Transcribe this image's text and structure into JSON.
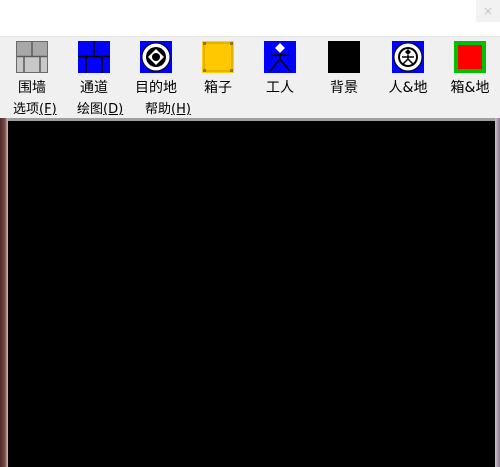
{
  "window": {
    "close_glyph": "×"
  },
  "toolbar": {
    "tools": [
      {
        "label": "围墙",
        "icon": "wall-icon"
      },
      {
        "label": "通道",
        "icon": "passage-icon"
      },
      {
        "label": "目的地",
        "icon": "target-icon"
      },
      {
        "label": "箱子",
        "icon": "box-icon"
      },
      {
        "label": "工人",
        "icon": "worker-icon"
      },
      {
        "label": "背景",
        "icon": "background-icon"
      },
      {
        "label": "人&地",
        "icon": "worker-on-target-icon"
      },
      {
        "label": "箱&地",
        "icon": "box-on-target-icon"
      }
    ]
  },
  "menu": {
    "items": [
      {
        "label": "选项",
        "hotkey": "(F)"
      },
      {
        "label": "绘图",
        "hotkey": "(D)"
      },
      {
        "label": "帮助",
        "hotkey": "(H)"
      }
    ]
  },
  "colors": {
    "toolbar_bg": "#f0f0f0",
    "canvas_bg": "#000000",
    "passage_blue": "#0000ff",
    "box_yellow": "#ffd200",
    "box_on_target_red": "#ff0000",
    "box_on_target_border": "#00c000"
  }
}
